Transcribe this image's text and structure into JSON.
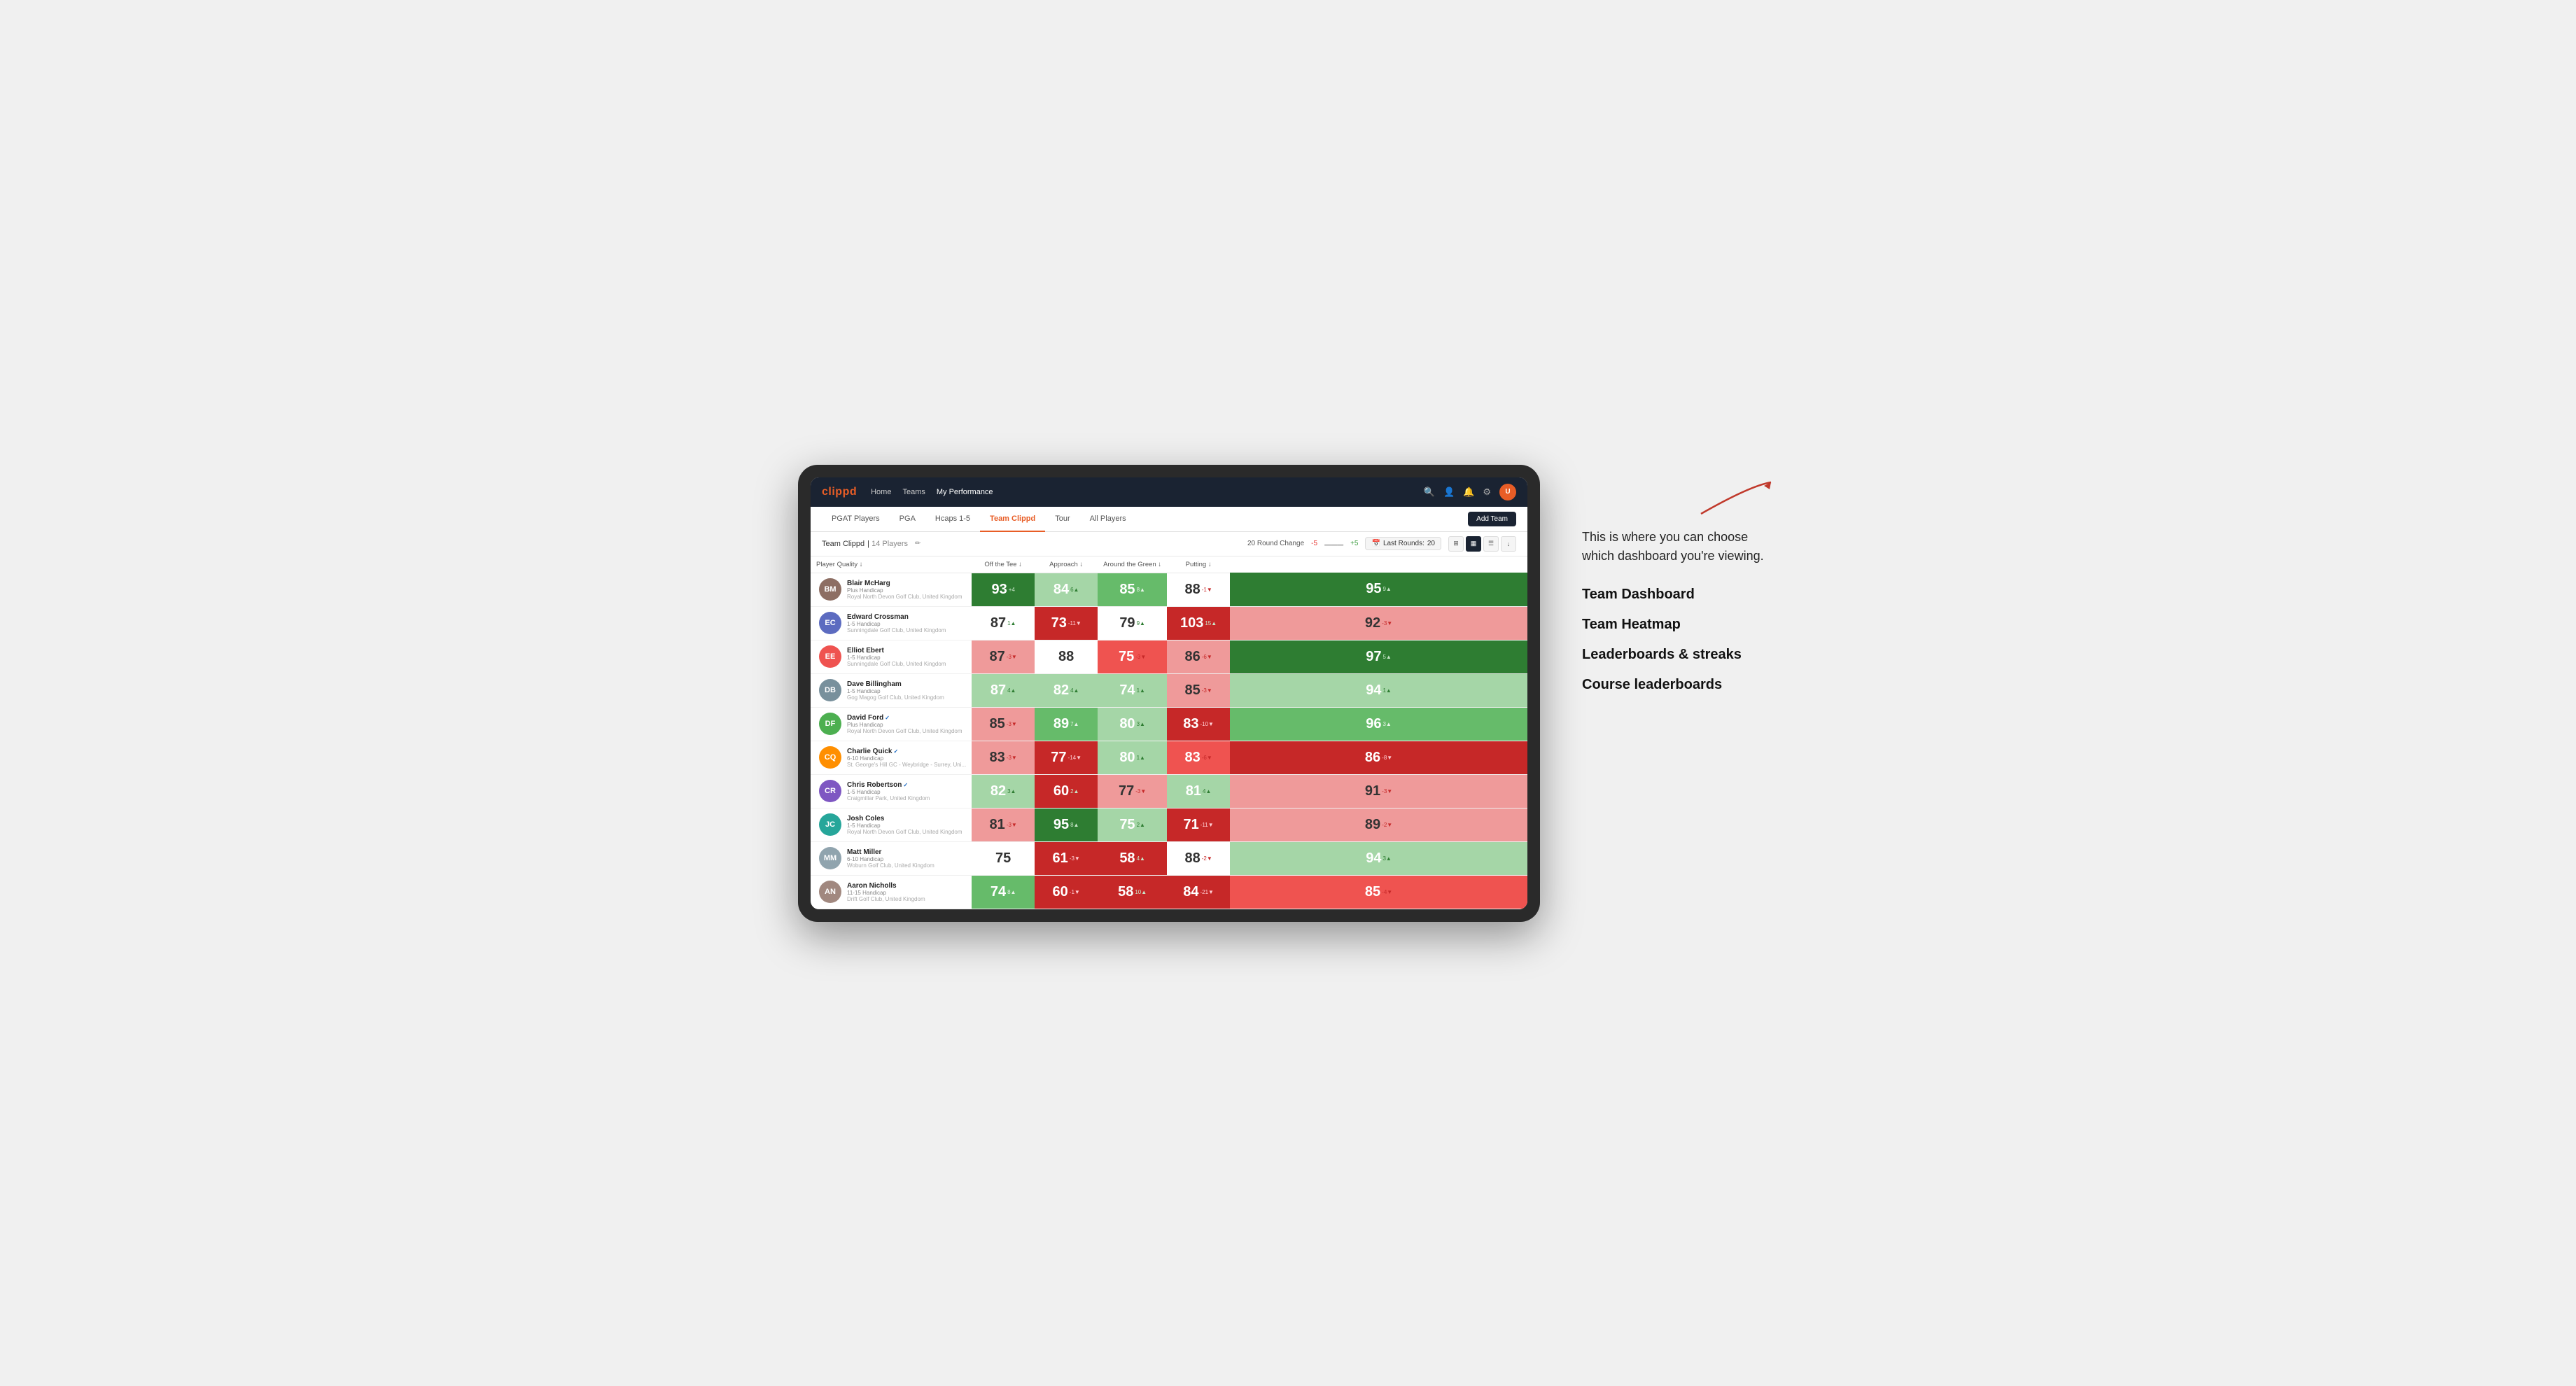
{
  "annotation": {
    "description": "This is where you can choose which dashboard you're viewing.",
    "items": [
      "Team Dashboard",
      "Team Heatmap",
      "Leaderboards & streaks",
      "Course leaderboards"
    ]
  },
  "nav": {
    "logo": "clippd",
    "links": [
      "Home",
      "Teams",
      "My Performance"
    ],
    "active_link": "My Performance"
  },
  "sub_nav": {
    "tabs": [
      "PGAT Players",
      "PGA",
      "Hcaps 1-5",
      "Team Clippd",
      "Tour",
      "All Players"
    ],
    "active_tab": "Team Clippd",
    "add_team_label": "Add Team"
  },
  "team_header": {
    "team_name": "Team Clippd",
    "player_count": "14 Players",
    "round_change_label": "20 Round Change",
    "neg_value": "-5",
    "pos_value": "+5",
    "last_rounds_label": "Last Rounds:",
    "last_rounds_value": "20"
  },
  "table": {
    "columns": [
      "Player Quality ↓",
      "Off the Tee ↓",
      "Approach ↓",
      "Around the Green ↓",
      "Putting ↓"
    ],
    "players": [
      {
        "name": "Blair McHarg",
        "handicap": "Plus Handicap",
        "club": "Royal North Devon Golf Club, United Kingdom",
        "verified": false,
        "avatar_color": "#8d6e63",
        "initials": "BM",
        "metrics": [
          {
            "value": 93,
            "change": "+4",
            "dir": "up",
            "bg": "bg-green-dark"
          },
          {
            "value": 84,
            "change": "6▲",
            "dir": "up",
            "bg": "bg-green-light"
          },
          {
            "value": 85,
            "change": "8▲",
            "dir": "up",
            "bg": "bg-green-med"
          },
          {
            "value": 88,
            "change": "-1▼",
            "dir": "down",
            "bg": "bg-white"
          },
          {
            "value": 95,
            "change": "9▲",
            "dir": "up",
            "bg": "bg-green-dark"
          }
        ]
      },
      {
        "name": "Edward Crossman",
        "handicap": "1-5 Handicap",
        "club": "Sunningdale Golf Club, United Kingdom",
        "verified": false,
        "avatar_color": "#5c6bc0",
        "initials": "EC",
        "metrics": [
          {
            "value": 87,
            "change": "1▲",
            "dir": "up",
            "bg": "bg-white"
          },
          {
            "value": 73,
            "change": "-11▼",
            "dir": "down",
            "bg": "bg-red-dark"
          },
          {
            "value": 79,
            "change": "9▲",
            "dir": "up",
            "bg": "bg-white"
          },
          {
            "value": 103,
            "change": "15▲",
            "dir": "up",
            "bg": "bg-red-dark"
          },
          {
            "value": 92,
            "change": "-3▼",
            "dir": "down",
            "bg": "bg-red-light"
          }
        ]
      },
      {
        "name": "Elliot Ebert",
        "handicap": "1-5 Handicap",
        "club": "Sunningdale Golf Club, United Kingdom",
        "verified": false,
        "avatar_color": "#ef5350",
        "initials": "EE",
        "metrics": [
          {
            "value": 87,
            "change": "-3▼",
            "dir": "down",
            "bg": "bg-red-light"
          },
          {
            "value": 88,
            "change": "",
            "dir": "",
            "bg": "bg-white"
          },
          {
            "value": 75,
            "change": "-3▼",
            "dir": "down",
            "bg": "bg-red-med"
          },
          {
            "value": 86,
            "change": "-6▼",
            "dir": "down",
            "bg": "bg-red-light"
          },
          {
            "value": 97,
            "change": "5▲",
            "dir": "up",
            "bg": "bg-green-dark"
          }
        ]
      },
      {
        "name": "Dave Billingham",
        "handicap": "1-5 Handicap",
        "club": "Gog Magog Golf Club, United Kingdom",
        "verified": false,
        "avatar_color": "#78909c",
        "initials": "DB",
        "metrics": [
          {
            "value": 87,
            "change": "4▲",
            "dir": "up",
            "bg": "bg-green-light"
          },
          {
            "value": 82,
            "change": "4▲",
            "dir": "up",
            "bg": "bg-green-light"
          },
          {
            "value": 74,
            "change": "1▲",
            "dir": "up",
            "bg": "bg-green-light"
          },
          {
            "value": 85,
            "change": "-3▼",
            "dir": "down",
            "bg": "bg-red-light"
          },
          {
            "value": 94,
            "change": "1▲",
            "dir": "up",
            "bg": "bg-green-light"
          }
        ]
      },
      {
        "name": "David Ford",
        "handicap": "Plus Handicap",
        "club": "Royal North Devon Golf Club, United Kingdom",
        "verified": true,
        "avatar_color": "#4caf50",
        "initials": "DF",
        "metrics": [
          {
            "value": 85,
            "change": "-3▼",
            "dir": "down",
            "bg": "bg-red-light"
          },
          {
            "value": 89,
            "change": "7▲",
            "dir": "up",
            "bg": "bg-green-med"
          },
          {
            "value": 80,
            "change": "3▲",
            "dir": "up",
            "bg": "bg-green-light"
          },
          {
            "value": 83,
            "change": "-10▼",
            "dir": "down",
            "bg": "bg-red-dark"
          },
          {
            "value": 96,
            "change": "3▲",
            "dir": "up",
            "bg": "bg-green-med"
          }
        ]
      },
      {
        "name": "Charlie Quick",
        "handicap": "6-10 Handicap",
        "club": "St. George's Hill GC - Weybridge - Surrey, Uni...",
        "verified": true,
        "avatar_color": "#ff8f00",
        "initials": "CQ",
        "metrics": [
          {
            "value": 83,
            "change": "-3▼",
            "dir": "down",
            "bg": "bg-red-light"
          },
          {
            "value": 77,
            "change": "-14▼",
            "dir": "down",
            "bg": "bg-red-dark"
          },
          {
            "value": 80,
            "change": "1▲",
            "dir": "up",
            "bg": "bg-green-light"
          },
          {
            "value": 83,
            "change": "-6▼",
            "dir": "down",
            "bg": "bg-red-med"
          },
          {
            "value": 86,
            "change": "-8▼",
            "dir": "down",
            "bg": "bg-red-dark"
          }
        ]
      },
      {
        "name": "Chris Robertson",
        "handicap": "1-5 Handicap",
        "club": "Craigmillar Park, United Kingdom",
        "verified": true,
        "avatar_color": "#7e57c2",
        "initials": "CR",
        "metrics": [
          {
            "value": 82,
            "change": "3▲",
            "dir": "up",
            "bg": "bg-green-light"
          },
          {
            "value": 60,
            "change": "2▲",
            "dir": "up",
            "bg": "bg-red-dark"
          },
          {
            "value": 77,
            "change": "-3▼",
            "dir": "down",
            "bg": "bg-red-light"
          },
          {
            "value": 81,
            "change": "4▲",
            "dir": "up",
            "bg": "bg-green-light"
          },
          {
            "value": 91,
            "change": "-3▼",
            "dir": "down",
            "bg": "bg-red-light"
          }
        ]
      },
      {
        "name": "Josh Coles",
        "handicap": "1-5 Handicap",
        "club": "Royal North Devon Golf Club, United Kingdom",
        "verified": false,
        "avatar_color": "#26a69a",
        "initials": "JC",
        "metrics": [
          {
            "value": 81,
            "change": "-3▼",
            "dir": "down",
            "bg": "bg-red-light"
          },
          {
            "value": 95,
            "change": "8▲",
            "dir": "up",
            "bg": "bg-green-dark"
          },
          {
            "value": 75,
            "change": "2▲",
            "dir": "up",
            "bg": "bg-green-light"
          },
          {
            "value": 71,
            "change": "-11▼",
            "dir": "down",
            "bg": "bg-red-dark"
          },
          {
            "value": 89,
            "change": "-2▼",
            "dir": "down",
            "bg": "bg-red-light"
          }
        ]
      },
      {
        "name": "Matt Miller",
        "handicap": "6-10 Handicap",
        "club": "Woburn Golf Club, United Kingdom",
        "verified": false,
        "avatar_color": "#90a4ae",
        "initials": "MM",
        "metrics": [
          {
            "value": 75,
            "change": "",
            "dir": "",
            "bg": "bg-white"
          },
          {
            "value": 61,
            "change": "-3▼",
            "dir": "down",
            "bg": "bg-red-dark"
          },
          {
            "value": 58,
            "change": "4▲",
            "dir": "up",
            "bg": "bg-red-dark"
          },
          {
            "value": 88,
            "change": "-2▼",
            "dir": "down",
            "bg": "bg-white"
          },
          {
            "value": 94,
            "change": "3▲",
            "dir": "up",
            "bg": "bg-green-light"
          }
        ]
      },
      {
        "name": "Aaron Nicholls",
        "handicap": "11-15 Handicap",
        "club": "Drift Golf Club, United Kingdom",
        "verified": false,
        "avatar_color": "#a1887f",
        "initials": "AN",
        "metrics": [
          {
            "value": 74,
            "change": "8▲",
            "dir": "up",
            "bg": "bg-green-med"
          },
          {
            "value": 60,
            "change": "-1▼",
            "dir": "down",
            "bg": "bg-red-dark"
          },
          {
            "value": 58,
            "change": "10▲",
            "dir": "up",
            "bg": "bg-red-dark"
          },
          {
            "value": 84,
            "change": "-21▼",
            "dir": "down",
            "bg": "bg-red-dark"
          },
          {
            "value": 85,
            "change": "-4▼",
            "dir": "down",
            "bg": "bg-red-med"
          }
        ]
      }
    ]
  }
}
